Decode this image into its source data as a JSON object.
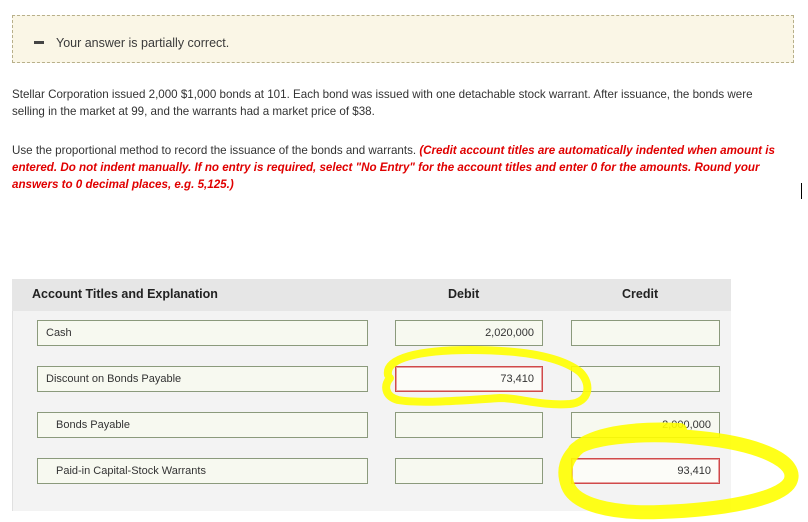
{
  "banner": {
    "message": "Your answer is partially correct."
  },
  "problem": {
    "text": "Stellar Corporation issued 2,000 $1,000 bonds at 101. Each bond was issued with one detachable stock warrant. After issuance, the bonds were selling in the market at 99, and the warrants had a market price of $38.",
    "instruction_plain": "Use the proportional method to record the issuance of the bonds and warrants. ",
    "instruction_red": "(Credit account titles are automatically indented when amount is entered. Do not indent manually. If no entry is required, select \"No Entry\" for the account titles and enter 0 for the amounts. Round your answers to 0 decimal places, e.g. 5,125.)"
  },
  "table": {
    "headers": {
      "account": "Account Titles and Explanation",
      "debit": "Debit",
      "credit": "Credit"
    },
    "rows": [
      {
        "account": "Cash",
        "debit": "2,020,000",
        "credit": ""
      },
      {
        "account": "Discount on Bonds Payable",
        "debit": "73,410",
        "credit": ""
      },
      {
        "account": "Bonds Payable",
        "debit": "",
        "credit": "2,000,000"
      },
      {
        "account": "Paid-in Capital-Stock Warrants",
        "debit": "",
        "credit": "93,410"
      }
    ]
  },
  "colors": {
    "highlight": "#ffff00",
    "error_border": "#d04a4a",
    "instruction_red": "#e00000"
  }
}
